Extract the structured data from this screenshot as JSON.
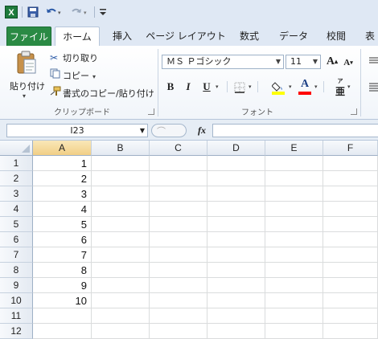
{
  "qat": {
    "app_icon": "excel-icon",
    "icons": [
      "save-icon",
      "undo-icon",
      "redo-icon",
      "customize-qat-icon"
    ]
  },
  "tabs": [
    {
      "label": "ファイル"
    },
    {
      "label": "ホーム"
    },
    {
      "label": "挿入"
    },
    {
      "label": "ページ レイアウト"
    },
    {
      "label": "数式"
    },
    {
      "label": "データ"
    },
    {
      "label": "校閲"
    },
    {
      "label": "表"
    }
  ],
  "clipboard": {
    "paste_label": "貼り付け",
    "cut_label": "切り取り",
    "copy_label": "コピー",
    "format_painter_label": "書式のコピー/貼り付け",
    "group_label": "クリップボード"
  },
  "font": {
    "font_name": "ＭＳ Ｐゴシック",
    "font_size": "11",
    "bold": "B",
    "italic": "I",
    "underline": "U",
    "font_color_glyph": "A",
    "grow_glyph": "A",
    "shrink_glyph": "A",
    "phonetic_glyph": "亜",
    "group_label": "フォント"
  },
  "formula_bar": {
    "name_box": "I23",
    "fx_label": "fx",
    "formula": ""
  },
  "sheet": {
    "columns": [
      "A",
      "B",
      "C",
      "D",
      "E",
      "F"
    ],
    "rows": [
      "1",
      "2",
      "3",
      "4",
      "5",
      "6",
      "7",
      "8",
      "9",
      "10",
      "11",
      "12"
    ],
    "colA_values": [
      "1",
      "2",
      "3",
      "4",
      "5",
      "6",
      "7",
      "8",
      "9",
      "10",
      "",
      ""
    ]
  },
  "colors": {
    "file_tab": "#2a8a44",
    "header_selected": "#f1cf86",
    "font_color_bar": "#ff0000",
    "highlight_bar": "#ffff00"
  }
}
